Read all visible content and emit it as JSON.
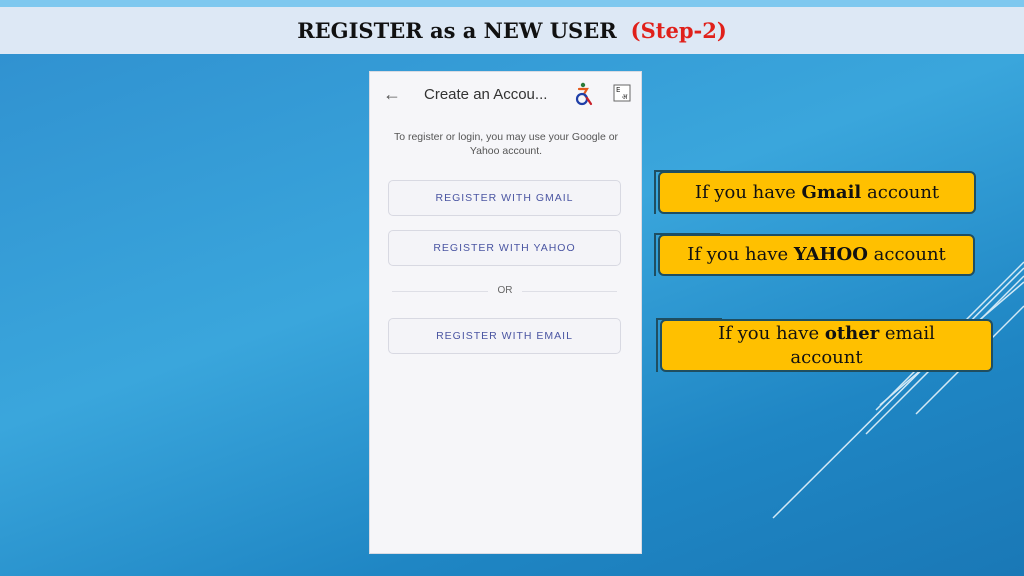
{
  "slide": {
    "title": "REGISTER as a NEW USER",
    "step": "(Step-2)"
  },
  "phone": {
    "header_title": "Create an Accou...",
    "back_icon": "back-arrow-icon",
    "accessibility_icon": "accessibility-icon",
    "language_icon": "language-toggle-icon",
    "info_text": "To register or login, you may use your Google or Yahoo account.",
    "buttons": {
      "gmail": "REGISTER WITH GMAIL",
      "yahoo": "REGISTER WITH YAHOO",
      "email": "REGISTER WITH EMAIL"
    },
    "or_label": "OR"
  },
  "callouts": {
    "gmail": {
      "prefix": "If you have ",
      "bold": "Gmail",
      "suffix": " account"
    },
    "yahoo": {
      "prefix": "If you have ",
      "bold": "YAHOO",
      "suffix": " account"
    },
    "other": {
      "prefix": "If you have ",
      "bold": "other",
      "suffix": " email account"
    }
  },
  "colors": {
    "callout_fill": "#ffc000",
    "callout_border": "#1f4e61",
    "step_text": "#e0201a",
    "button_text": "#4a55a2"
  }
}
